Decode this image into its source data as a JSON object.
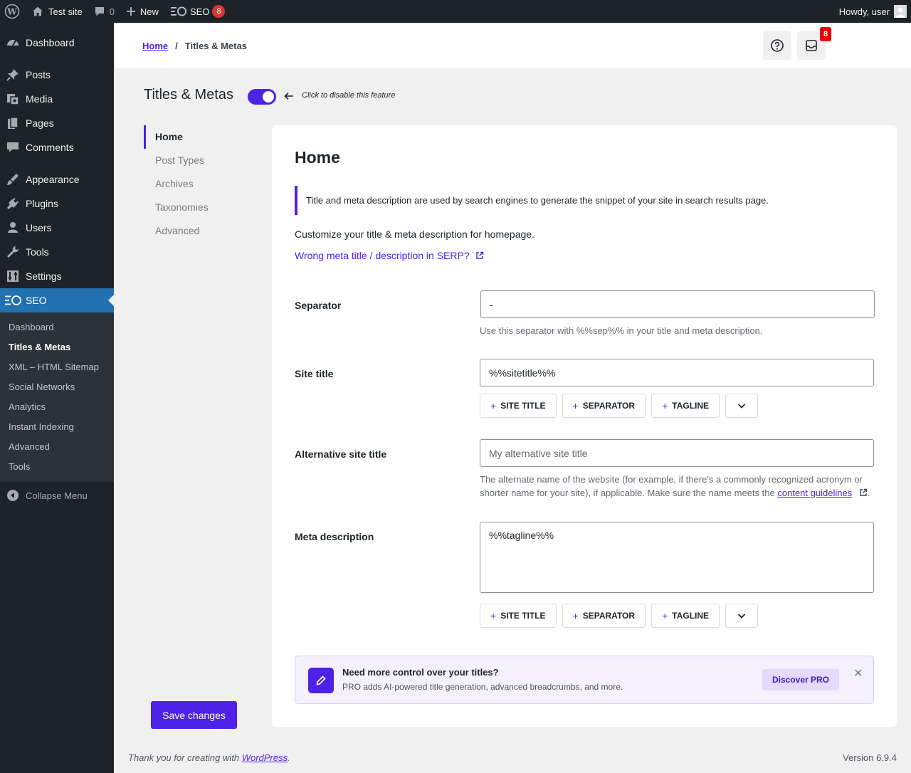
{
  "adminbar": {
    "site_name": "Test site",
    "comments_count": "0",
    "new_label": "New",
    "seo_label": "SEO",
    "seo_badge": "8",
    "greeting": "Howdy, user"
  },
  "sidebar": {
    "items": [
      {
        "label": "Dashboard"
      },
      {
        "label": "Posts"
      },
      {
        "label": "Media"
      },
      {
        "label": "Pages"
      },
      {
        "label": "Comments"
      },
      {
        "label": "Appearance"
      },
      {
        "label": "Plugins"
      },
      {
        "label": "Users"
      },
      {
        "label": "Tools"
      },
      {
        "label": "Settings"
      },
      {
        "label": "SEO"
      }
    ],
    "submenu": [
      {
        "label": "Dashboard"
      },
      {
        "label": "Titles & Metas"
      },
      {
        "label": "XML – HTML Sitemap"
      },
      {
        "label": "Social Networks"
      },
      {
        "label": "Analytics"
      },
      {
        "label": "Instant Indexing"
      },
      {
        "label": "Advanced"
      },
      {
        "label": "Tools"
      }
    ],
    "collapse_label": "Collapse Menu"
  },
  "header": {
    "breadcrumb_home": "Home",
    "breadcrumb_sep": "/",
    "breadcrumb_current": "Titles & Metas",
    "notifications_badge": "8"
  },
  "page": {
    "title": "Titles & Metas",
    "toggle_on": true,
    "toggle_hint": "Click to disable this feature",
    "save_label": "Save changes"
  },
  "subnav": {
    "items": [
      {
        "label": "Home"
      },
      {
        "label": "Post Types"
      },
      {
        "label": "Archives"
      },
      {
        "label": "Taxonomies"
      },
      {
        "label": "Advanced"
      }
    ]
  },
  "card": {
    "title": "Home",
    "notice": "Title and meta description are used by search engines to generate the snippet of your site in search results page.",
    "intro": "Customize your title & meta description for homepage.",
    "serp_link": "Wrong meta title / description in SERP?",
    "separator": {
      "label": "Separator",
      "value": "-",
      "desc": "Use this separator with %%sep%% in your title and meta description."
    },
    "site_title": {
      "label": "Site title",
      "value": "%%sitetitle%%"
    },
    "alt_title": {
      "label": "Alternative site title",
      "placeholder": "My alternative site title",
      "desc_before": "The alternate name of the website (for example, if there's a commonly recognized acronym or shorter name for your site), if applicable. Make sure the name meets the",
      "desc_link": "content guidelines",
      "desc_after": "."
    },
    "meta_desc": {
      "label": "Meta description",
      "value": "%%tagline%%"
    },
    "tags": {
      "site_title": "SITE TITLE",
      "separator": "SEPARATOR",
      "tagline": "TAGLINE",
      "plus": "+"
    },
    "promo": {
      "title": "Need more control over your titles?",
      "text": "PRO adds AI-powered title generation, advanced breadcrumbs, and more.",
      "button": "Discover PRO",
      "close": "✕"
    }
  },
  "footer": {
    "thanks_before": "Thank you for creating with",
    "thanks_link": "WordPress",
    "thanks_after": ".",
    "version": "Version 6.9.4"
  },
  "colors": {
    "accent": "#4e21e7",
    "admin_dark": "#1d2327",
    "admin_blue": "#2271b1",
    "badge_red": "#d63638"
  }
}
